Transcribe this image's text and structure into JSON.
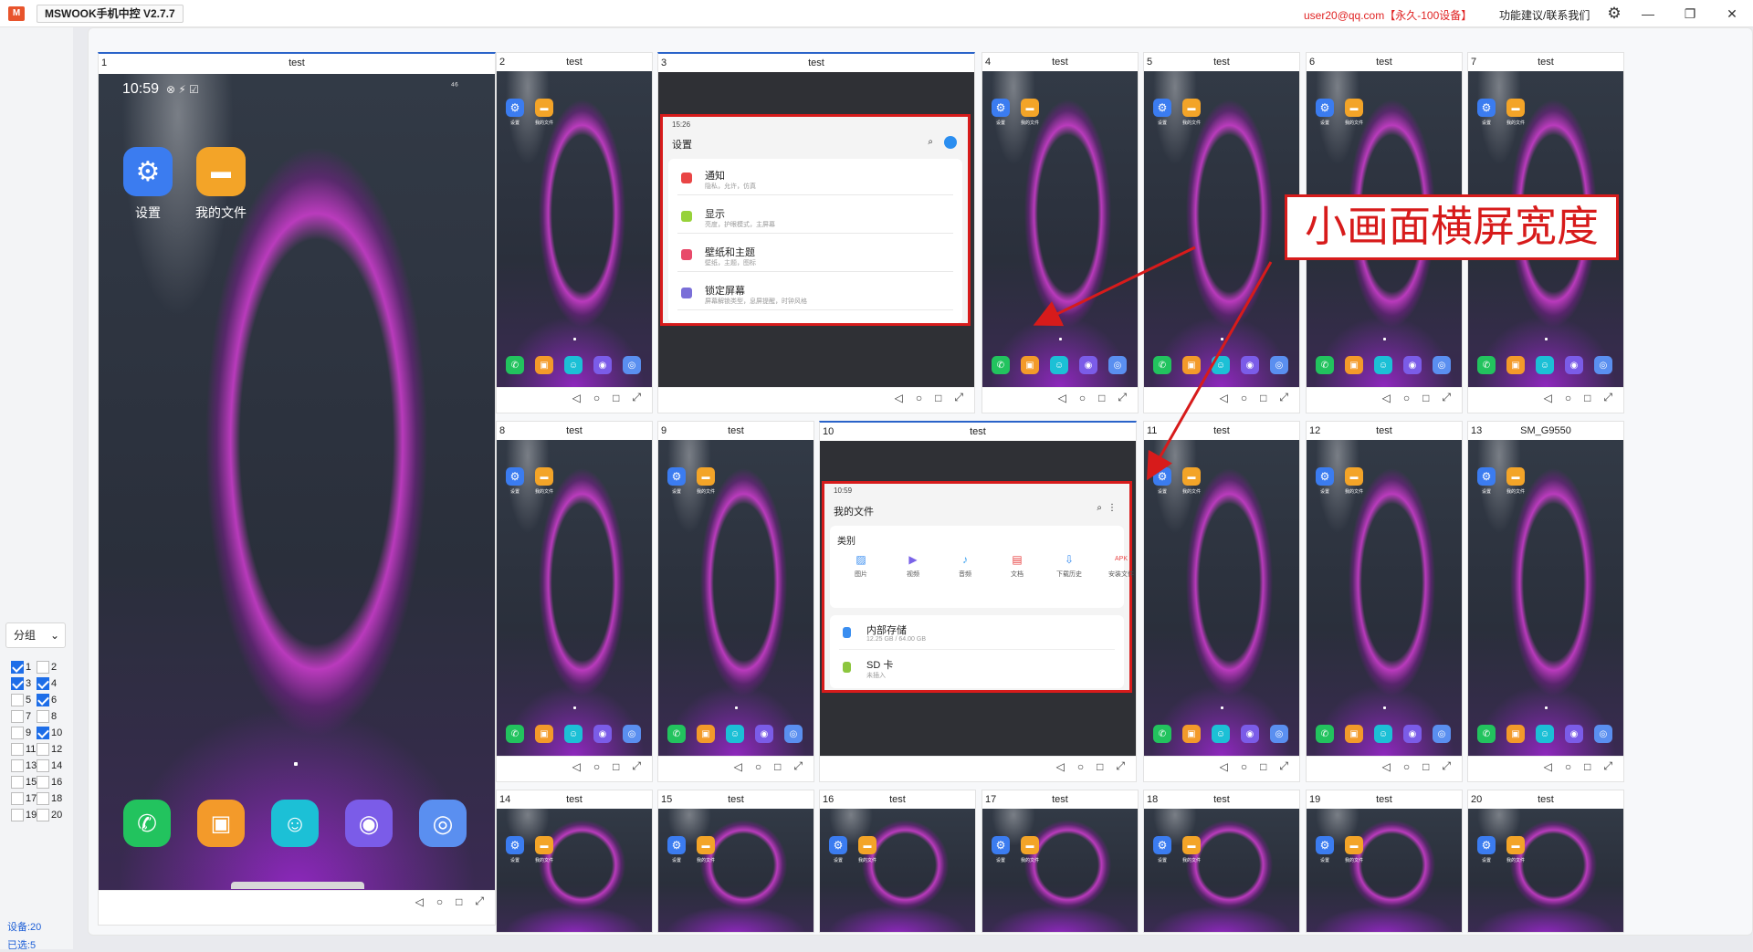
{
  "window": {
    "logo_text": "M",
    "title": "MSWOOK手机中控 V2.7.7",
    "user": "user20@qq.com【永久-100设备】",
    "feedback": "功能建议/联系我们",
    "settings_icon": "⚙",
    "minimize": "—",
    "restore": "❐",
    "close": "✕"
  },
  "sidebar": {
    "group_label": "分组",
    "chevron": "⌄",
    "devices": [
      {
        "num": "1",
        "checked": true
      },
      {
        "num": "2",
        "checked": false
      },
      {
        "num": "3",
        "checked": true
      },
      {
        "num": "4",
        "checked": true
      },
      {
        "num": "5",
        "checked": false
      },
      {
        "num": "6",
        "checked": true
      },
      {
        "num": "7",
        "checked": false
      },
      {
        "num": "8",
        "checked": false
      },
      {
        "num": "9",
        "checked": false
      },
      {
        "num": "10",
        "checked": true
      },
      {
        "num": "11",
        "checked": false
      },
      {
        "num": "12",
        "checked": false
      },
      {
        "num": "13",
        "checked": false
      },
      {
        "num": "14",
        "checked": false
      },
      {
        "num": "15",
        "checked": false
      },
      {
        "num": "16",
        "checked": false
      },
      {
        "num": "17",
        "checked": false
      },
      {
        "num": "18",
        "checked": false
      },
      {
        "num": "19",
        "checked": false
      },
      {
        "num": "20",
        "checked": false
      }
    ],
    "device_count": "设备:20",
    "selected_count": "已选:5"
  },
  "nav_icons": {
    "back": "◁",
    "home": "○",
    "recent": "□",
    "expand": "⤢"
  },
  "big_phone": {
    "num": "1",
    "name": "test",
    "time": "10:59",
    "status_icons": "⊗ ⚡ ☑",
    "signal": "⁴⁶",
    "apps": [
      {
        "label": "设置",
        "icon": "⚙",
        "color": "#3b7cf0"
      },
      {
        "label": "我的文件",
        "icon": "▬",
        "color": "#f3a428"
      }
    ],
    "dock": [
      {
        "icon": "✆",
        "color": "#22c35e"
      },
      {
        "icon": "▣",
        "color": "#f39a2a"
      },
      {
        "icon": "☺",
        "color": "#1cc0d6"
      },
      {
        "icon": "◉",
        "color": "#7b5ce8"
      },
      {
        "icon": "◎",
        "color": "#5a8ff0"
      }
    ]
  },
  "devices": [
    {
      "num": "2",
      "name": "test"
    },
    {
      "num": "3",
      "name": "test"
    },
    {
      "num": "4",
      "name": "test"
    },
    {
      "num": "5",
      "name": "test"
    },
    {
      "num": "6",
      "name": "test"
    },
    {
      "num": "7",
      "name": "test"
    },
    {
      "num": "8",
      "name": "test"
    },
    {
      "num": "9",
      "name": "test"
    },
    {
      "num": "10",
      "name": "test"
    },
    {
      "num": "11",
      "name": "test"
    },
    {
      "num": "12",
      "name": "test"
    },
    {
      "num": "13",
      "name": "SM_G9550"
    },
    {
      "num": "14",
      "name": "test"
    },
    {
      "num": "15",
      "name": "test"
    },
    {
      "num": "16",
      "name": "test"
    },
    {
      "num": "17",
      "name": "test"
    },
    {
      "num": "18",
      "name": "test"
    },
    {
      "num": "19",
      "name": "test"
    },
    {
      "num": "20",
      "name": "test"
    }
  ],
  "small_labels": {
    "settings": "设置",
    "files": "我的文件"
  },
  "settings_screen": {
    "time": "15:26",
    "title": "设置",
    "items": [
      {
        "title": "通知",
        "sub": "隐私，允许，仿真",
        "color": "#e94545"
      },
      {
        "title": "显示",
        "sub": "亮度，护眼模式，主屏幕",
        "color": "#97d23a"
      },
      {
        "title": "壁纸和主题",
        "sub": "壁纸，主题，图标",
        "color": "#e84a6a"
      },
      {
        "title": "锁定屏幕",
        "sub": "屏幕解锁类型，息屏提醒，时钟风格",
        "color": "#7a6fd8"
      }
    ]
  },
  "files_screen": {
    "time": "10:59",
    "title": "我的文件",
    "category_title": "类别",
    "categories": [
      {
        "label": "图片",
        "icon": "▨",
        "color": "#3a8ef0"
      },
      {
        "label": "视频",
        "icon": "▶",
        "color": "#7a63e8"
      },
      {
        "label": "音频",
        "icon": "♪",
        "color": "#3aa0f0"
      },
      {
        "label": "文档",
        "icon": "▤",
        "color": "#e84545"
      },
      {
        "label": "下载历史",
        "icon": "⇩",
        "color": "#3a8ef0"
      },
      {
        "label": "安装文件",
        "icon": "APK",
        "color": "#e84545"
      }
    ],
    "storage": [
      {
        "title": "内部存储",
        "sub": "12.25 GB / 64.00 GB",
        "color": "#3a8ef0"
      },
      {
        "title": "SD 卡",
        "sub": "未插入",
        "color": "#8cc63e"
      }
    ]
  },
  "annotation": "小画面横屏宽度"
}
